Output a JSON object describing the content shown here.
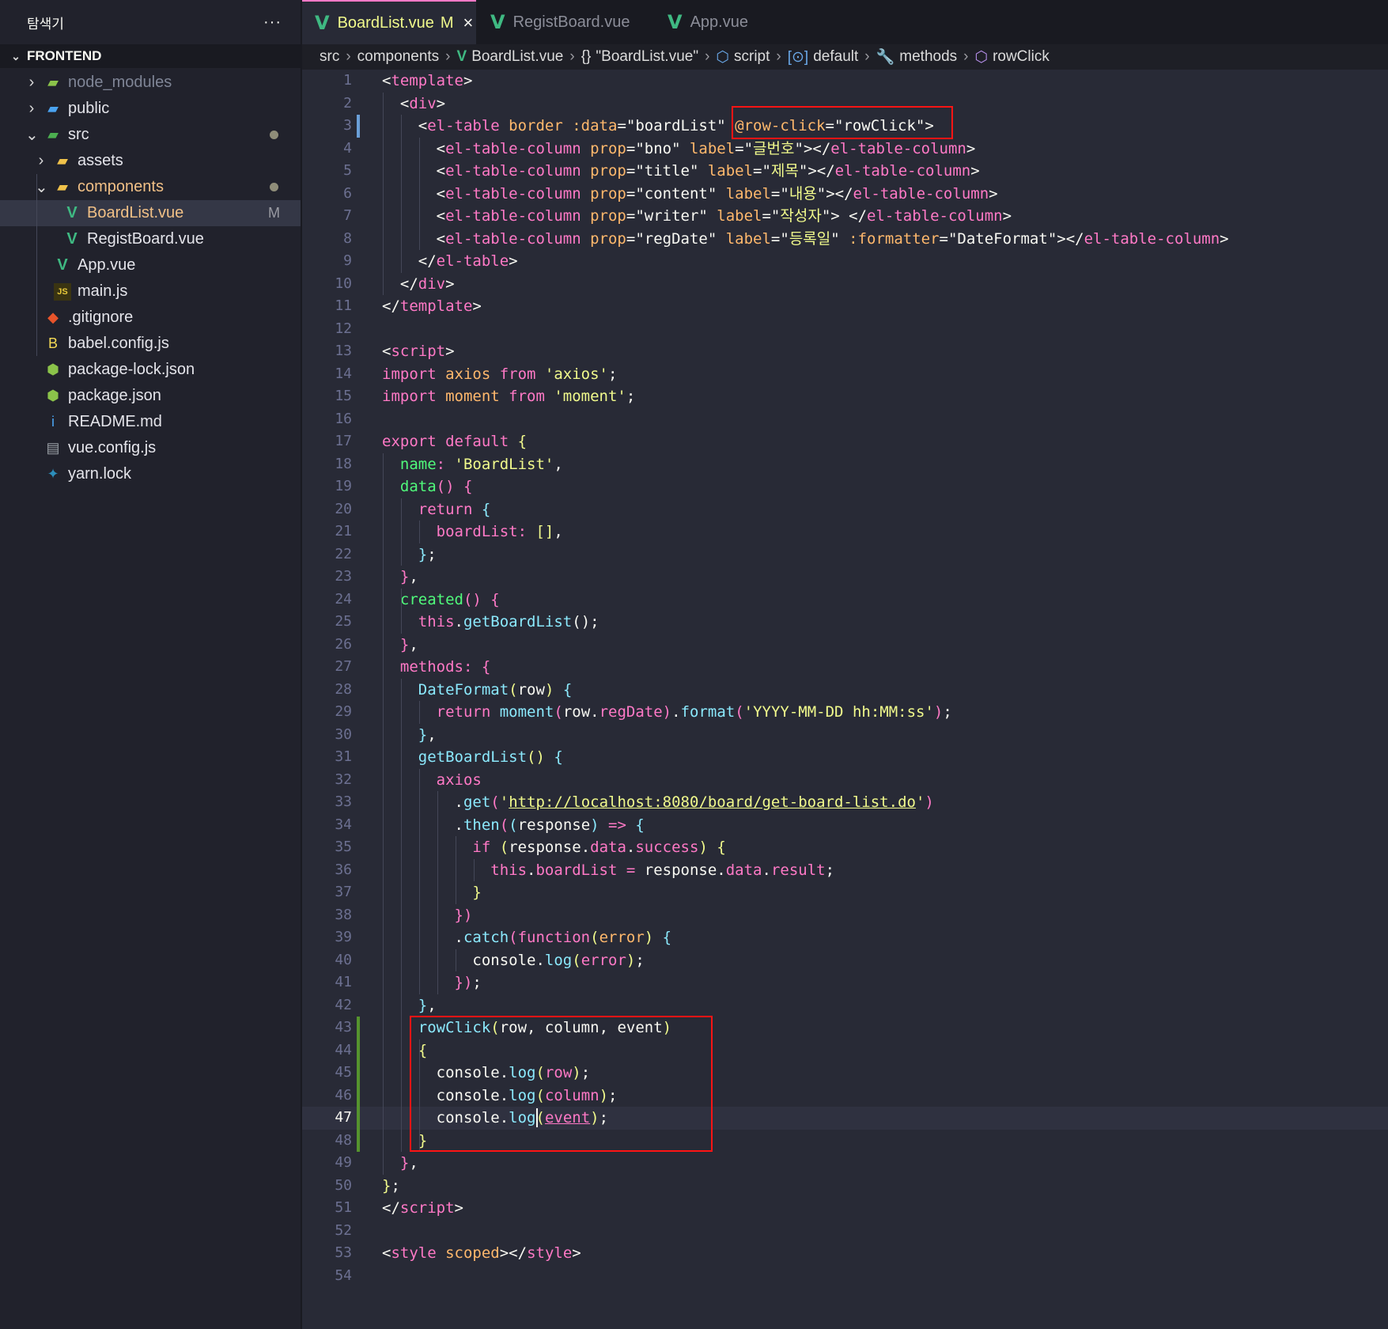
{
  "explorer": {
    "title": "탐색기",
    "more": "···",
    "section": "FRONTEND",
    "items": [
      {
        "label": "node_modules",
        "icon": "folder-node-icon",
        "kind": "folder",
        "color": "#7f8596"
      },
      {
        "label": "public",
        "icon": "folder-public-icon",
        "kind": "folder",
        "color": "#e4e4ea"
      },
      {
        "label": "src",
        "icon": "folder-src-icon",
        "kind": "folder-open",
        "color": "#e4e4ea"
      },
      {
        "label": "assets",
        "icon": "folder-assets-icon",
        "kind": "folder",
        "color": "#e4e4ea"
      },
      {
        "label": "components",
        "icon": "folder-components-icon",
        "kind": "folder-open",
        "color": "#f1c086"
      },
      {
        "label": "BoardList.vue",
        "icon": "vue-icon",
        "kind": "file",
        "color": "#f1c086",
        "badge": "M"
      },
      {
        "label": "RegistBoard.vue",
        "icon": "vue-icon",
        "kind": "file",
        "color": "#e4e4ea"
      },
      {
        "label": "App.vue",
        "icon": "vue-icon",
        "kind": "file",
        "color": "#e4e4ea"
      },
      {
        "label": "main.js",
        "icon": "javascript-icon",
        "kind": "file",
        "color": "#e4e4ea"
      },
      {
        "label": ".gitignore",
        "icon": "git-icon",
        "kind": "file",
        "color": "#e4e4ea"
      },
      {
        "label": "babel.config.js",
        "icon": "babel-icon",
        "kind": "file",
        "color": "#e4e4ea"
      },
      {
        "label": "package-lock.json",
        "icon": "nodejs-icon",
        "kind": "file",
        "color": "#e4e4ea"
      },
      {
        "label": "package.json",
        "icon": "nodejs-icon",
        "kind": "file",
        "color": "#e4e4ea"
      },
      {
        "label": "README.md",
        "icon": "info-icon",
        "kind": "file",
        "color": "#e4e4ea"
      },
      {
        "label": "vue.config.js",
        "icon": "config-file-icon",
        "kind": "file",
        "color": "#e4e4ea"
      },
      {
        "label": "yarn.lock",
        "icon": "yarn-icon",
        "kind": "file",
        "color": "#e4e4ea"
      }
    ]
  },
  "tabs": [
    {
      "label": "BoardList.vue",
      "modified": "M",
      "close": "×",
      "active": true
    },
    {
      "label": "RegistBoard.vue",
      "active": false
    },
    {
      "label": "App.vue",
      "active": false
    }
  ],
  "breadcrumb": {
    "src": "src",
    "components": "components",
    "file": "BoardList.vue",
    "json_scope": "\"BoardList.vue\"",
    "script": "script",
    "default": "default",
    "methods": "methods",
    "method": "rowClick"
  },
  "colors": {
    "tag": "#ff79c6",
    "attr": "#50fa7b",
    "string": "#f1fa8c",
    "keyword": "#ff79c6",
    "function": "#50fa7b",
    "property": "#ff79c6",
    "text": "#f8f8f2",
    "highlight_box": "#ff1414"
  },
  "code": [
    [
      [
        "<",
        "#f8f8f2"
      ],
      [
        "template",
        "#ff79c6"
      ],
      [
        ">",
        "#f8f8f2"
      ]
    ],
    [
      [
        "  <",
        "#f8f8f2"
      ],
      [
        "div",
        "#ff79c6"
      ],
      [
        ">",
        "#f8f8f2"
      ]
    ],
    [
      [
        "    <",
        "#f8f8f2"
      ],
      [
        "el-table",
        "#ff79c6"
      ],
      [
        " border :data",
        "#ffb86c"
      ],
      [
        "=\"boardList\" ",
        "#f8f8f2"
      ],
      [
        "@row-click",
        "#ffb86c"
      ],
      [
        "=\"rowClick\">",
        "#f8f8f2"
      ]
    ],
    [
      [
        "      <",
        "#f8f8f2"
      ],
      [
        "el-table-column",
        "#ff79c6"
      ],
      [
        " prop",
        "#ffb86c"
      ],
      [
        "=\"bno\" ",
        "#f8f8f2"
      ],
      [
        "label",
        "#ffb86c"
      ],
      [
        "=\"",
        "#f8f8f2"
      ],
      [
        "글번호",
        "#f1fa8c"
      ],
      [
        "\"></",
        "#f8f8f2"
      ],
      [
        "el-table-column",
        "#ff79c6"
      ],
      [
        ">",
        "#f8f8f2"
      ]
    ],
    [
      [
        "      <",
        "#f8f8f2"
      ],
      [
        "el-table-column",
        "#ff79c6"
      ],
      [
        " prop",
        "#ffb86c"
      ],
      [
        "=\"title\" ",
        "#f8f8f2"
      ],
      [
        "label",
        "#ffb86c"
      ],
      [
        "=\"",
        "#f8f8f2"
      ],
      [
        "제목",
        "#f1fa8c"
      ],
      [
        "\"></",
        "#f8f8f2"
      ],
      [
        "el-table-column",
        "#ff79c6"
      ],
      [
        ">",
        "#f8f8f2"
      ]
    ],
    [
      [
        "      <",
        "#f8f8f2"
      ],
      [
        "el-table-column",
        "#ff79c6"
      ],
      [
        " prop",
        "#ffb86c"
      ],
      [
        "=\"content\" ",
        "#f8f8f2"
      ],
      [
        "label",
        "#ffb86c"
      ],
      [
        "=\"",
        "#f8f8f2"
      ],
      [
        "내용",
        "#f1fa8c"
      ],
      [
        "\"></",
        "#f8f8f2"
      ],
      [
        "el-table-column",
        "#ff79c6"
      ],
      [
        ">",
        "#f8f8f2"
      ]
    ],
    [
      [
        "      <",
        "#f8f8f2"
      ],
      [
        "el-table-column",
        "#ff79c6"
      ],
      [
        " prop",
        "#ffb86c"
      ],
      [
        "=\"writer\" ",
        "#f8f8f2"
      ],
      [
        "label",
        "#ffb86c"
      ],
      [
        "=\"",
        "#f8f8f2"
      ],
      [
        "작성자",
        "#f1fa8c"
      ],
      [
        "\"> </",
        "#f8f8f2"
      ],
      [
        "el-table-column",
        "#ff79c6"
      ],
      [
        ">",
        "#f8f8f2"
      ]
    ],
    [
      [
        "      <",
        "#f8f8f2"
      ],
      [
        "el-table-column",
        "#ff79c6"
      ],
      [
        " prop",
        "#ffb86c"
      ],
      [
        "=\"regDate\" ",
        "#f8f8f2"
      ],
      [
        "label",
        "#ffb86c"
      ],
      [
        "=\"",
        "#f8f8f2"
      ],
      [
        "등록일",
        "#f1fa8c"
      ],
      [
        "\" ",
        "#f8f8f2"
      ],
      [
        ":formatter",
        "#ffb86c"
      ],
      [
        "=\"DateFormat\"></",
        "#f8f8f2"
      ],
      [
        "el-table-column",
        "#ff79c6"
      ],
      [
        ">",
        "#f8f8f2"
      ]
    ],
    [
      [
        "    </",
        "#f8f8f2"
      ],
      [
        "el-table",
        "#ff79c6"
      ],
      [
        ">",
        "#f8f8f2"
      ]
    ],
    [
      [
        "  </",
        "#f8f8f2"
      ],
      [
        "div",
        "#ff79c6"
      ],
      [
        ">",
        "#f8f8f2"
      ]
    ],
    [
      [
        "</",
        "#f8f8f2"
      ],
      [
        "template",
        "#ff79c6"
      ],
      [
        ">",
        "#f8f8f2"
      ]
    ],
    [],
    [
      [
        "<",
        "#f8f8f2"
      ],
      [
        "script",
        "#ff79c6"
      ],
      [
        ">",
        "#f8f8f2"
      ]
    ],
    [
      [
        "import ",
        "#ff79c6"
      ],
      [
        "axios ",
        "#ffb86c"
      ],
      [
        "from ",
        "#ff79c6"
      ],
      [
        "'axios'",
        "#f1fa8c"
      ],
      [
        ";",
        "#f8f8f2"
      ]
    ],
    [
      [
        "import ",
        "#ff79c6"
      ],
      [
        "moment ",
        "#ffb86c"
      ],
      [
        "from ",
        "#ff79c6"
      ],
      [
        "'moment'",
        "#f1fa8c"
      ],
      [
        ";",
        "#f8f8f2"
      ]
    ],
    [],
    [
      [
        "export default ",
        "#ff79c6"
      ],
      [
        "{",
        "#f1fa8c"
      ]
    ],
    [
      [
        "  name",
        "#50fa7b"
      ],
      [
        ": ",
        "#ff79c6"
      ],
      [
        "'BoardList'",
        "#f1fa8c"
      ],
      [
        ",",
        "#f8f8f2"
      ]
    ],
    [
      [
        "  data",
        "#50fa7b"
      ],
      [
        "() ",
        "#ff79c6"
      ],
      [
        "{",
        "#ff79c6"
      ]
    ],
    [
      [
        "    return ",
        "#ff79c6"
      ],
      [
        "{",
        "#8be9fd"
      ]
    ],
    [
      [
        "      boardList",
        "#ff79c6"
      ],
      [
        ": ",
        "#ff79c6"
      ],
      [
        "[]",
        "#f1fa8c"
      ],
      [
        ",",
        "#f8f8f2"
      ]
    ],
    [
      [
        "    }",
        "#8be9fd"
      ],
      [
        ";",
        "#f8f8f2"
      ]
    ],
    [
      [
        "  }",
        "#ff79c6"
      ],
      [
        ",",
        "#f8f8f2"
      ]
    ],
    [
      [
        "  created",
        "#50fa7b"
      ],
      [
        "() ",
        "#ff79c6"
      ],
      [
        "{",
        "#ff79c6"
      ]
    ],
    [
      [
        "    this",
        "#ff79c6"
      ],
      [
        ".",
        "#f8f8f2"
      ],
      [
        "getBoardList",
        "#8be9fd"
      ],
      [
        "();",
        "#f8f8f2"
      ]
    ],
    [
      [
        "  }",
        "#ff79c6"
      ],
      [
        ",",
        "#f8f8f2"
      ]
    ],
    [
      [
        "  methods",
        "#ff79c6"
      ],
      [
        ": ",
        "#ff79c6"
      ],
      [
        "{",
        "#ff79c6"
      ]
    ],
    [
      [
        "    DateFormat",
        "#8be9fd"
      ],
      [
        "(",
        "#f1fa8c"
      ],
      [
        "row",
        "#f8f8f2"
      ],
      [
        ") ",
        "#f1fa8c"
      ],
      [
        "{",
        "#8be9fd"
      ]
    ],
    [
      [
        "      return ",
        "#ff79c6"
      ],
      [
        "moment",
        "#8be9fd"
      ],
      [
        "(",
        "#ff79c6"
      ],
      [
        "row",
        "#f8f8f2"
      ],
      [
        ".",
        "#f8f8f2"
      ],
      [
        "regDate",
        "#ff79c6"
      ],
      [
        ")",
        "#ff79c6"
      ],
      [
        ".",
        "#f8f8f2"
      ],
      [
        "format",
        "#8be9fd"
      ],
      [
        "(",
        "#ff79c6"
      ],
      [
        "'YYYY-MM-DD hh:MM:ss'",
        "#f1fa8c"
      ],
      [
        ")",
        "#ff79c6"
      ],
      [
        ";",
        "#f8f8f2"
      ]
    ],
    [
      [
        "    }",
        "#8be9fd"
      ],
      [
        ",",
        "#f8f8f2"
      ]
    ],
    [
      [
        "    getBoardList",
        "#8be9fd"
      ],
      [
        "() ",
        "#f1fa8c"
      ],
      [
        "{",
        "#8be9fd"
      ]
    ],
    [
      [
        "      axios",
        "#ff79c6"
      ]
    ],
    [
      [
        "        .",
        "#f8f8f2"
      ],
      [
        "get",
        "#8be9fd"
      ],
      [
        "(",
        "#ff79c6"
      ],
      [
        "'",
        "#f1fa8c"
      ],
      [
        "http://localhost:8080/board/get-board-list.do",
        "#f1fa8c",
        "u"
      ],
      [
        "'",
        "#f1fa8c"
      ],
      [
        ")",
        "#ff79c6"
      ]
    ],
    [
      [
        "        .",
        "#f8f8f2"
      ],
      [
        "then",
        "#8be9fd"
      ],
      [
        "(",
        "#ff79c6"
      ],
      [
        "(",
        "#8be9fd"
      ],
      [
        "response",
        "#f8f8f2"
      ],
      [
        ") ",
        "#8be9fd"
      ],
      [
        "=> ",
        "#ff79c6"
      ],
      [
        "{",
        "#8be9fd"
      ]
    ],
    [
      [
        "          if ",
        "#ff79c6"
      ],
      [
        "(",
        "#f1fa8c"
      ],
      [
        "response",
        "#f8f8f2"
      ],
      [
        ".",
        "#f8f8f2"
      ],
      [
        "data",
        "#ff79c6"
      ],
      [
        ".",
        "#f8f8f2"
      ],
      [
        "success",
        "#ff79c6"
      ],
      [
        ") ",
        "#f1fa8c"
      ],
      [
        "{",
        "#f1fa8c"
      ]
    ],
    [
      [
        "            this",
        "#ff79c6"
      ],
      [
        ".",
        "#f8f8f2"
      ],
      [
        "boardList ",
        "#ff79c6"
      ],
      [
        "= ",
        "#ff79c6"
      ],
      [
        "response",
        "#f8f8f2"
      ],
      [
        ".",
        "#f8f8f2"
      ],
      [
        "data",
        "#ff79c6"
      ],
      [
        ".",
        "#f8f8f2"
      ],
      [
        "result",
        "#ff79c6"
      ],
      [
        ";",
        "#f8f8f2"
      ]
    ],
    [
      [
        "          }",
        "#f1fa8c"
      ]
    ],
    [
      [
        "        })",
        "#ff79c6"
      ]
    ],
    [
      [
        "        .",
        "#f8f8f2"
      ],
      [
        "catch",
        "#8be9fd"
      ],
      [
        "(",
        "#ff79c6"
      ],
      [
        "function",
        "#ff79c6"
      ],
      [
        "(",
        "#f1fa8c"
      ],
      [
        "error",
        "#ffb86c"
      ],
      [
        ") ",
        "#f1fa8c"
      ],
      [
        "{",
        "#8be9fd"
      ]
    ],
    [
      [
        "          console",
        "#f8f8f2"
      ],
      [
        ".",
        "#f8f8f2"
      ],
      [
        "log",
        "#8be9fd"
      ],
      [
        "(",
        "#f1fa8c"
      ],
      [
        "error",
        "#ff79c6"
      ],
      [
        ")",
        "#f1fa8c"
      ],
      [
        ";",
        "#f8f8f2"
      ]
    ],
    [
      [
        "        })",
        "#ff79c6"
      ],
      [
        ";",
        "#f8f8f2"
      ]
    ],
    [
      [
        "    }",
        "#8be9fd"
      ],
      [
        ",",
        "#f8f8f2"
      ]
    ],
    [
      [
        "    rowClick",
        "#8be9fd"
      ],
      [
        "(",
        "#f1fa8c"
      ],
      [
        "row, column, event",
        "#f8f8f2"
      ],
      [
        ")",
        "#f1fa8c"
      ]
    ],
    [
      [
        "    {",
        "#f1fa8c"
      ]
    ],
    [
      [
        "      console",
        "#f8f8f2"
      ],
      [
        ".",
        "#f8f8f2"
      ],
      [
        "log",
        "#8be9fd"
      ],
      [
        "(",
        "#f1fa8c"
      ],
      [
        "row",
        "#ff79c6"
      ],
      [
        ")",
        "#f1fa8c"
      ],
      [
        ";",
        "#f8f8f2"
      ]
    ],
    [
      [
        "      console",
        "#f8f8f2"
      ],
      [
        ".",
        "#f8f8f2"
      ],
      [
        "log",
        "#8be9fd"
      ],
      [
        "(",
        "#f1fa8c"
      ],
      [
        "column",
        "#ff79c6"
      ],
      [
        ")",
        "#f1fa8c"
      ],
      [
        ";",
        "#f8f8f2"
      ]
    ],
    [
      [
        "      console",
        "#f8f8f2"
      ],
      [
        ".",
        "#f8f8f2"
      ],
      [
        "log",
        "#8be9fd"
      ],
      [
        "(",
        "#f1fa8c"
      ],
      [
        "event",
        "#ff79c6",
        "u"
      ],
      [
        ")",
        "#f1fa8c"
      ],
      [
        ";",
        "#f8f8f2"
      ]
    ],
    [
      [
        "    }",
        "#f1fa8c"
      ]
    ],
    [
      [
        "  }",
        "#ff79c6"
      ],
      [
        ",",
        "#f8f8f2"
      ]
    ],
    [
      [
        "}",
        "#f1fa8c"
      ],
      [
        ";",
        "#f8f8f2"
      ]
    ],
    [
      [
        "</",
        "#f8f8f2"
      ],
      [
        "script",
        "#ff79c6"
      ],
      [
        ">",
        "#f8f8f2"
      ]
    ],
    [],
    [
      [
        "<",
        "#f8f8f2"
      ],
      [
        "style ",
        "#ff79c6"
      ],
      [
        "scoped",
        "#ffb86c"
      ],
      [
        "></",
        "#f8f8f2"
      ],
      [
        "style",
        "#ff79c6"
      ],
      [
        ">",
        "#f8f8f2"
      ]
    ],
    []
  ],
  "cursor_line": 47
}
